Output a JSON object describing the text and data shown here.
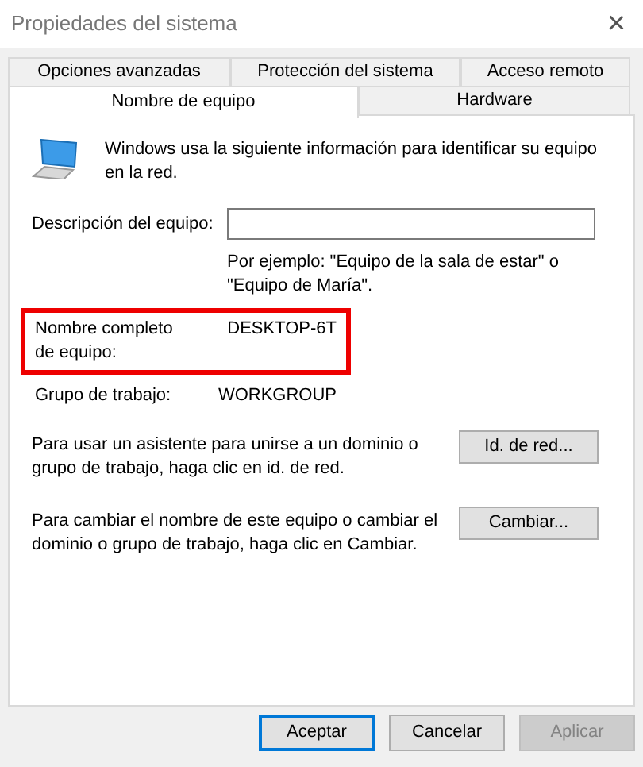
{
  "window": {
    "title": "Propiedades del sistema",
    "close": "×"
  },
  "tab_rows": [
    [
      {
        "label": "Opciones avanzadas",
        "selected": false
      },
      {
        "label": "Protección del sistema",
        "selected": false
      },
      {
        "label": "Acceso remoto",
        "selected": false
      }
    ],
    [
      {
        "label": "Nombre de equipo",
        "selected": true
      },
      {
        "label": "Hardware",
        "selected": false
      }
    ]
  ],
  "intro": "Windows usa la siguiente información para identificar su equipo en la red.",
  "description": {
    "label": "Descripción del equipo:",
    "hint": "Por ejemplo: \"Equipo de la sala de estar\" o \"Equipo de María\"."
  },
  "fields": [
    {
      "label": "Nombre completo de equipo:",
      "value": "DESKTOP-6T",
      "highlighted": true
    },
    {
      "label": "Grupo de trabajo:",
      "value": "WORKGROUP",
      "highlighted": false
    }
  ],
  "actions": [
    {
      "text": "Para usar un asistente para unirse a un dominio o grupo de trabajo, haga clic en id. de red.",
      "button": "Id. de red..."
    },
    {
      "text": "Para cambiar el nombre de este equipo o cambiar el dominio o grupo de trabajo, haga clic en Cambiar.",
      "button": "Cambiar..."
    }
  ],
  "buttons": [
    {
      "label": "Aceptar",
      "default": true,
      "disabled": false
    },
    {
      "label": "Cancelar",
      "default": false,
      "disabled": false
    },
    {
      "label": "Aplicar",
      "default": false,
      "disabled": true
    }
  ]
}
